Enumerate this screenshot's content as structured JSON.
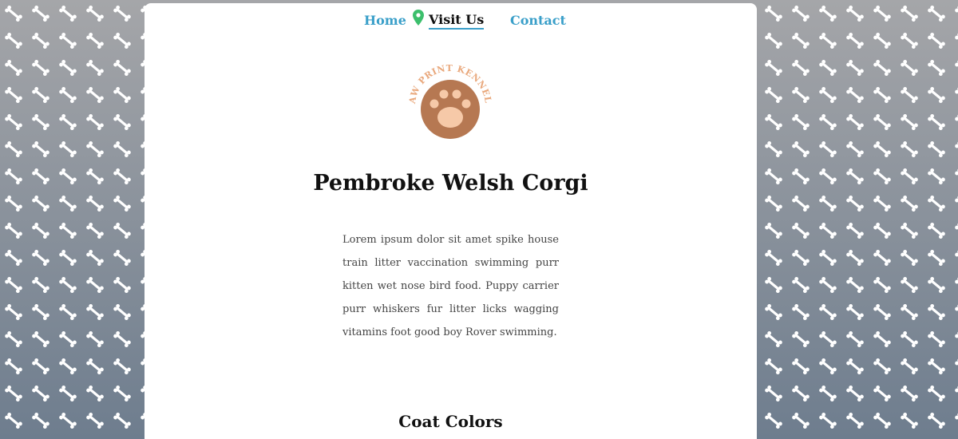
{
  "nav": {
    "home": "Home",
    "visit_us": "Visit Us",
    "contact": "Contact"
  },
  "logo": {
    "text": "PAW PRINT KENNELS"
  },
  "page": {
    "title": "Pembroke Welsh Corgi",
    "intro": "Lorem ipsum dolor sit amet spike house train litter vaccination swimming purr kitten wet nose bird food. Puppy carrier purr whiskers fur litter licks wagging vitamins foot good boy Rover swimming.",
    "section_heading": "Coat Colors"
  },
  "colors": {
    "nav_link": "#3a9fc9",
    "active_underline": "#3a9fc9",
    "pin": "#3cbf6c",
    "logo_text": "#e9a87c",
    "logo_circle": "#b67852",
    "logo_pad": "#f6c9a8"
  },
  "icons": {
    "pin": "map-pin-icon",
    "paw": "paw-icon"
  }
}
